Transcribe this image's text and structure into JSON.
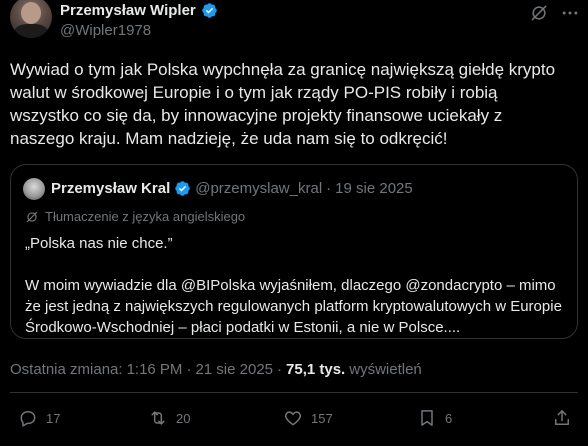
{
  "author": {
    "display_name": "Przemysław Wipler",
    "handle": "@Wipler1978"
  },
  "tweet": {
    "text": "Wywiad o tym jak Polska wypchnęła za granicę największą giełdę krypto walut w środkowej Europie i o tym jak rządy PO-PIS robiły i robią wszystko co się da, by innowacyjne projekty finansowe uciekały z naszego kraju. Mam nadzieję, że uda nam się to odkręcić!"
  },
  "quote": {
    "display_name": "Przemysław Kral",
    "handle": "@przemyslaw_kral",
    "separator": "·",
    "date": "19 sie 2025",
    "translation_label": "Tłumaczenie z języka angielskiego",
    "line1": "„Polska nas nie chce.”",
    "line2": "W moim wywiadzie dla @BIPolska wyjaśniłem, dlaczego @zondacrypto – mimo że jest jedną z największych regulowanych platform kryptowalutowych w Europie Środkowo-Wschodniej – płaci podatki w Estonii, a nie w Polsce...."
  },
  "meta": {
    "prefix": "Ostatnia zmiana:",
    "time": "1:16 PM",
    "dot1": "·",
    "date": "21 sie 2025",
    "dot2": "·",
    "views_count": "75,1 tys.",
    "views_label": "wyświetleń"
  },
  "actions": {
    "replies": "17",
    "reposts": "20",
    "likes": "157",
    "bookmarks": "6"
  },
  "colors": {
    "background": "#000000",
    "text": "#e7e9ea",
    "muted": "#71767b",
    "verified": "#1d9bf0",
    "border": "#2f3336"
  }
}
